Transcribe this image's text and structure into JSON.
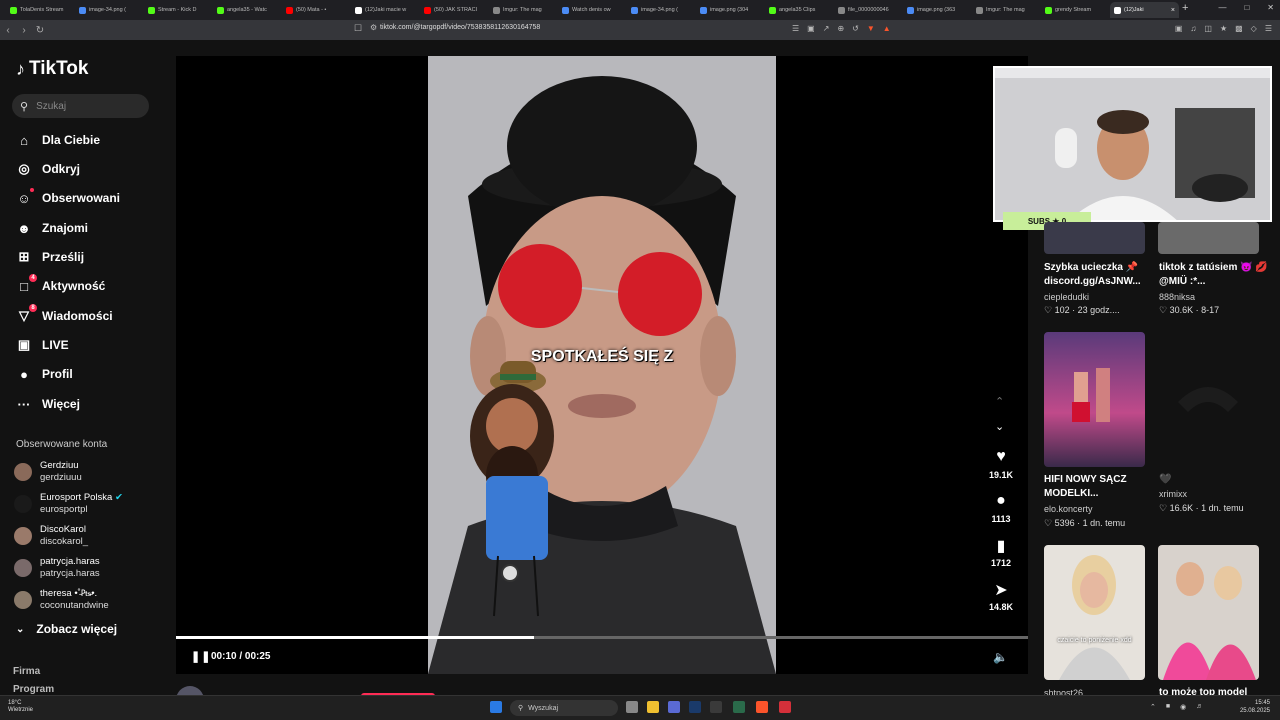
{
  "browser": {
    "tabs": [
      {
        "label": "TolaDenis Stream",
        "color": "#53fc18"
      },
      {
        "label": "image-34.png (",
        "color": "#4b8bf5"
      },
      {
        "label": "Stream - Kick D",
        "color": "#53fc18"
      },
      {
        "label": "angela35 - Watc",
        "color": "#53fc18"
      },
      {
        "label": "(50) Mata - •",
        "color": "#ff0000"
      },
      {
        "label": "(12)Jaki macie w",
        "color": "#ffffff"
      },
      {
        "label": "(50) JAK STRACI",
        "color": "#ff0000"
      },
      {
        "label": "Imgur: The mag",
        "color": "#888888"
      },
      {
        "label": "Watch denis ow",
        "color": "#4b8bf5"
      },
      {
        "label": "image-34.png (",
        "color": "#4b8bf5"
      },
      {
        "label": "image.png (304",
        "color": "#4b8bf5"
      },
      {
        "label": "angela35 Clips",
        "color": "#53fc18"
      },
      {
        "label": "file_0000000046",
        "color": "#888888"
      },
      {
        "label": "image.png (363",
        "color": "#4b8bf5"
      },
      {
        "label": "Imgur: The mag",
        "color": "#888888"
      },
      {
        "label": "grendy Stream",
        "color": "#53fc18"
      },
      {
        "label": "(12)Jaki",
        "color": "#ffffff",
        "active": true
      }
    ],
    "url": "tiktok.com/@targopdf/video/7538358112630164758"
  },
  "sidebar": {
    "logo": "TikTok",
    "search_placeholder": "Szukaj",
    "nav": [
      {
        "label": "Dla Ciebie",
        "icon": "home-icon",
        "glyph": "⌂"
      },
      {
        "label": "Odkryj",
        "icon": "compass-icon",
        "glyph": "◎"
      },
      {
        "label": "Obserwowani",
        "icon": "following-icon",
        "glyph": "☺",
        "dot": true
      },
      {
        "label": "Znajomi",
        "icon": "friends-icon",
        "glyph": "☻"
      },
      {
        "label": "Prześlij",
        "icon": "upload-icon",
        "glyph": "⊞"
      },
      {
        "label": "Aktywność",
        "icon": "activity-icon",
        "glyph": "□",
        "badge": "4"
      },
      {
        "label": "Wiadomości",
        "icon": "messages-icon",
        "glyph": "▽",
        "badge": "8"
      },
      {
        "label": "LIVE",
        "icon": "live-icon",
        "glyph": "▣"
      },
      {
        "label": "Profil",
        "icon": "profile-icon",
        "glyph": "●"
      },
      {
        "label": "Więcej",
        "icon": "more-icon",
        "glyph": "···"
      }
    ],
    "followed_header": "Obserwowane konta",
    "accounts": [
      {
        "name": "Gerdziuu",
        "user": "gerdziuuu",
        "color": "#8a6a5a"
      },
      {
        "name": "Eurosport Polska",
        "user": "eurosportpl",
        "color": "#1a1a1a",
        "verified": true
      },
      {
        "name": "DiscoKarol",
        "user": "discokarol_",
        "color": "#9a7a6a"
      },
      {
        "name": "patrycja.haras",
        "user": "patrycja.haras",
        "color": "#7a6a6a"
      },
      {
        "name": "theresa •˚̵₧̵•.",
        "user": "coconutandwine",
        "color": "#8a7a6a"
      }
    ],
    "see_more": "Zobacz więcej",
    "footer": [
      "Firma",
      "Program"
    ]
  },
  "video": {
    "caption": "SPOTKAŁEŚ SIĘ Z",
    "time": "00:10 / 00:25",
    "progress": 0.42,
    "author": "targopdf"
  },
  "actions": {
    "likes": "19.1K",
    "comments": "1113",
    "saves": "1712",
    "shares": "14.8K"
  },
  "webcam": {
    "overlay": "SUBS ★ 0"
  },
  "recommended": [
    {
      "title": "Szybka ucieczka 📌 discord.gg/AsJNW...",
      "user": "ciepledudki",
      "likes": "102",
      "age": "23 godz...."
    },
    {
      "title": "tiktok z tatúsiem 😈 💋@MIÜ :*...",
      "user": "888niksa",
      "likes": "30.6K",
      "age": "8-17"
    },
    {
      "title": "HIFI NOWY SĄCZ MODELKI...",
      "user": "elo.koncerty",
      "likes": "5396",
      "age": "1 dn. temu"
    },
    {
      "title": "🖤",
      "user": "xrimixx",
      "likes": "16.6K",
      "age": "1 dn. temu"
    },
    {
      "title": "",
      "user": "shtpost26",
      "likes": "",
      "age": "",
      "thumb_text": "czaicie to poniżenie xdd"
    },
    {
      "title": "to może top model",
      "user": "",
      "likes": "",
      "age": ""
    }
  ],
  "taskbar": {
    "weather_temp": "18°C",
    "weather_desc": "Wietrznie",
    "search": "Wyszukaj",
    "time": "15:45",
    "date": "25.08.2025"
  }
}
